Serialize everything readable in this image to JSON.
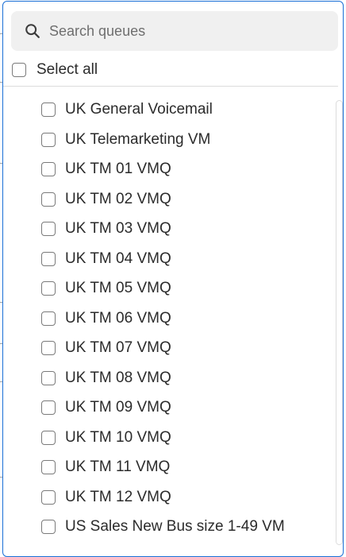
{
  "search": {
    "placeholder": "Search queues",
    "value": "",
    "icon": "search-icon"
  },
  "select_all": {
    "label": "Select all",
    "checked": false
  },
  "queues": [
    {
      "label": "UK General Voicemail",
      "checked": false
    },
    {
      "label": "UK Telemarketing VM",
      "checked": false
    },
    {
      "label": "UK TM 01 VMQ",
      "checked": false
    },
    {
      "label": "UK TM 02 VMQ",
      "checked": false
    },
    {
      "label": "UK TM 03 VMQ",
      "checked": false
    },
    {
      "label": "UK TM 04 VMQ",
      "checked": false
    },
    {
      "label": "UK TM 05 VMQ",
      "checked": false
    },
    {
      "label": "UK TM 06 VMQ",
      "checked": false
    },
    {
      "label": "UK TM 07 VMQ",
      "checked": false
    },
    {
      "label": "UK TM 08 VMQ",
      "checked": false
    },
    {
      "label": "UK TM 09 VMQ",
      "checked": false
    },
    {
      "label": "UK TM 10 VMQ",
      "checked": false
    },
    {
      "label": "UK TM 11 VMQ",
      "checked": false
    },
    {
      "label": "UK TM 12 VMQ",
      "checked": false
    },
    {
      "label": "US Sales New Bus size 1-49 VM",
      "checked": false
    }
  ],
  "colors": {
    "accent_border": "#1a6fd6",
    "search_bg": "#f0f0f0",
    "checkbox_border": "#7a7a7a",
    "divider": "#dcdcdc"
  }
}
